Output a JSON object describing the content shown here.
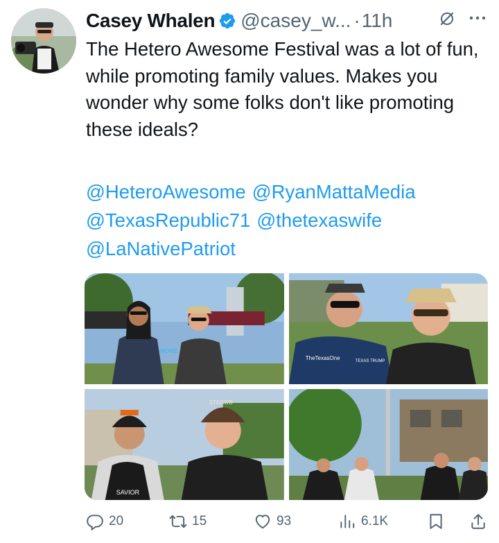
{
  "author": {
    "name": "Casey Whalen",
    "handle": "@casey_w...",
    "separator": "·",
    "time": "11h"
  },
  "tweet": {
    "text": "The Hetero Awesome Festival was a lot of fun, while promoting family values. Makes you wonder why some folks don't like promoting these ideals?",
    "mentions": [
      "@HeteroAwesome",
      "@RyanMattaMedia",
      "@TexasRepublic71",
      "@thetexaswife",
      "@LaNativePatriot"
    ]
  },
  "media": {
    "photo_text": {
      "shirt_1": "TheTexasOne",
      "shirt_2": "TEXAS TRUMP",
      "cap_1": "MONE",
      "cap_2": "STRAWB",
      "shirt_3": "SAVIOR"
    }
  },
  "actions": {
    "replies": "20",
    "reposts": "15",
    "likes": "93",
    "views": "6.1K"
  },
  "icons": {
    "verified": "verified-badge-icon",
    "grok": "grok-icon",
    "more": "more-icon",
    "reply": "reply-icon",
    "repost": "repost-icon",
    "like": "like-icon",
    "views": "views-icon",
    "bookmark": "bookmark-icon",
    "share": "share-icon"
  },
  "colors": {
    "accent": "#1d9bf0",
    "text": "#0f1419",
    "muted": "#536471"
  }
}
